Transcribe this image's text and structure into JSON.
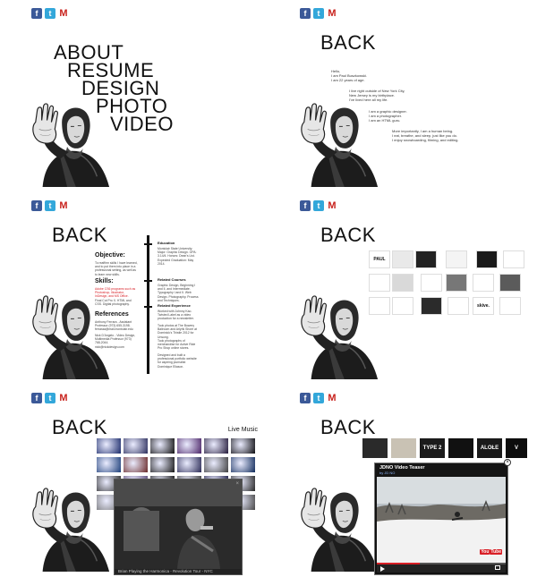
{
  "social": {
    "facebook": "f",
    "twitter": "t",
    "gmail": "M"
  },
  "menu": [
    "ABOUT",
    "RESUME",
    "DESIGN",
    "PHOTO",
    "VIDEO"
  ],
  "back_label": "BACK",
  "about": {
    "p1": [
      "Hello,",
      "I am Paul Buszkowski.",
      "I am 22 years of age."
    ],
    "p2": [
      "I live right outside of New York City,",
      "New Jersey is my birthplace.",
      "I've lived here all my life."
    ],
    "p3": [
      "I am a graphic designer.",
      "I am a photographer.",
      "I am an HTML guru."
    ],
    "p4": [
      "More importantly, I am a human being.",
      "I eat, breathe, and sleep, just like you do.",
      "I enjoy snowboarding, filming, and editing."
    ]
  },
  "resume": {
    "objective_title": "Objective:",
    "objective_text": "To reaffirm skills I have learned, and to put them into place in a professional setting, as well as to learn new skills.",
    "skills_title": "Skills:",
    "skills_text": "Adobe CS6 programs such as Photoshop, Illustrator, InDesign, and MS Office.",
    "skills_text2": "Final Cut Pro X. HTML and CSS. Digital photography.",
    "references_title": "References",
    "references_text": "Anthony Ferrara - Assistant Professor (973) 655-3198. ferraraa@mail.montclair.edu",
    "references_text2": "Nick D'Angelo - Video Design, Multimedia Professor (973) 768-2044. nick@nickdesign.com",
    "education_title": "Education",
    "education_text": "Montclair State University. Major: Graphic Design. GPA: 3.14/4. Honors: Dean's List. Expected Graduation: May 2014.",
    "courses_title": "Related Courses",
    "courses_text": "Graphic Design, Beginning I and II, and Intermediate. Typography I and II. Web Design. Photography. Process and Techniques.",
    "experience_title": "Related Experience",
    "experience_text": "Worked with Johnny Kao. Twisted Label as a video production for a newsletter.",
    "experience_text2": "Took photos at The Bowery Ballroom and Arlyrik Shore at Dominick's Thistle 2012 for Unsung.",
    "experience_text3": "Took photographs of merchandise for Active Ride Pro Shop online stores.",
    "experience_text4": "Designed and built a professional portfolio website for aspiring journalist Dominique Eliason."
  },
  "design_thumbs": [
    {
      "label": "PAUL",
      "bg": "#ffffff",
      "fg": "#111111"
    },
    {
      "label": "",
      "bg": "#e9e9e9",
      "fg": "#111111"
    },
    {
      "label": "",
      "bg": "#222222",
      "fg": "#ffffff"
    },
    {
      "label": "",
      "bg": "#f4f4f4",
      "fg": "#111111"
    },
    {
      "label": "",
      "bg": "#1a1a1a",
      "fg": "#ffffff"
    },
    {
      "label": "",
      "bg": "#ffffff",
      "fg": "#d81f26"
    },
    {
      "label": "",
      "bg": "#ffffff",
      "fg": "#111111"
    },
    {
      "label": "",
      "bg": "#d9d9d9",
      "fg": "#111111"
    },
    {
      "label": "",
      "bg": "#ffffff",
      "fg": "#111111"
    },
    {
      "label": "",
      "bg": "#777777",
      "fg": "#ffffff"
    },
    {
      "label": "",
      "bg": "#ffffff",
      "fg": "#111111"
    },
    {
      "label": "",
      "bg": "#5b5b5b",
      "fg": "#ffffff"
    },
    {
      "label": "",
      "bg": "#ffffff",
      "fg": "#111111"
    },
    {
      "label": "",
      "bg": "#ffffff",
      "fg": "#111111"
    },
    {
      "label": "",
      "bg": "#2b2b2b",
      "fg": "#ffffff"
    },
    {
      "label": "",
      "bg": "#ffffff",
      "fg": "#d81f26"
    },
    {
      "label": "skive.",
      "bg": "#ffffff",
      "fg": "#111111"
    },
    {
      "label": "",
      "bg": "#ffffff",
      "fg": "#111111"
    }
  ],
  "photo": {
    "title": "Live Music",
    "caption": "Brian Playing the Harmonica - Revolution Tour - NYC",
    "thumb_colors": [
      "#1a2a6a",
      "#2b2e5c",
      "#101010",
      "#4a2366",
      "#241a3a",
      "#0c0c10",
      "#1d3f7a",
      "#6a2a2a",
      "#171717",
      "#2a2a55",
      "#404040",
      "#0f2a5a",
      "#2c2c2c",
      "#5a4a7a",
      "#111111",
      "#3a3a3a",
      "#1a1a44",
      "#262626",
      "#6b6b6b",
      "#222244",
      "#333333",
      "#121212",
      "#1e1e3c",
      "#474747"
    ]
  },
  "video": {
    "thumbs": [
      {
        "label": "",
        "bg": "#2a2a2a"
      },
      {
        "label": "",
        "bg": "#c9c2b4"
      },
      {
        "label": "TYPE 2",
        "bg": "#1b1b1b"
      },
      {
        "label": "",
        "bg": "#111111"
      },
      {
        "label": "ALOŁE",
        "bg": "#1a1a1a"
      },
      {
        "label": "V",
        "bg": "#0d0d0d"
      }
    ],
    "title": "JDNO Video Teaser",
    "author": "by JD NO",
    "progress": 0.33,
    "brand": "You",
    "brand2": "Tube"
  },
  "close_glyph": "×"
}
